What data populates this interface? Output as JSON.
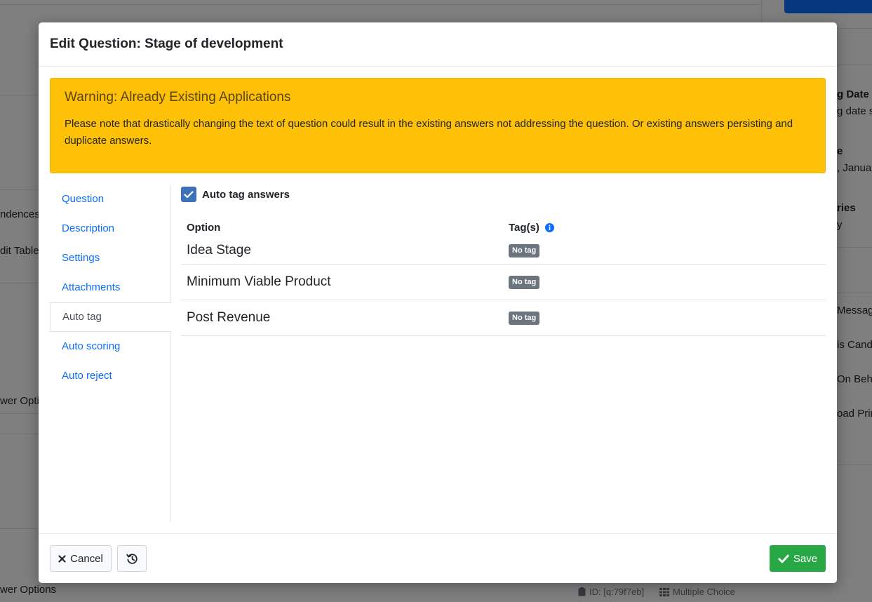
{
  "background": {
    "left_fragments": [
      "ndences",
      "dit Table",
      "wer Opti",
      "wer Options"
    ],
    "right_fragments": [
      "g Date",
      "g date se",
      "e",
      ", Janua",
      "ries",
      "y",
      "Message",
      "is Candi",
      "On Beha",
      "oad Prin"
    ],
    "footer": {
      "id_label": "ID: [q:79f7eb]",
      "type_label": "Multiple Choice"
    }
  },
  "modal": {
    "title": "Edit Question: Stage of development",
    "alert": {
      "heading": "Warning: Already Existing Applications",
      "text": "Please note that drastically changing the text of question could result in the existing answers not addressing the question. Or existing answers persisting and duplicate answers."
    },
    "nav": [
      {
        "label": "Question",
        "active": false
      },
      {
        "label": "Description",
        "active": false
      },
      {
        "label": "Settings",
        "active": false
      },
      {
        "label": "Attachments",
        "active": false
      },
      {
        "label": "Auto tag",
        "active": true
      },
      {
        "label": "Auto scoring",
        "active": false
      },
      {
        "label": "Auto reject",
        "active": false
      }
    ],
    "auto_tag": {
      "checkbox_label": "Auto tag answers",
      "checked": true,
      "columns": {
        "option": "Option",
        "tags": "Tag(s)"
      },
      "rows": [
        {
          "option": "Idea Stage",
          "tag": "No tag"
        },
        {
          "option": "Minimum Viable Product",
          "tag": "No tag"
        },
        {
          "option": "Post Revenue",
          "tag": "No tag"
        }
      ]
    },
    "footer": {
      "cancel_label": "Cancel",
      "save_label": "Save"
    }
  },
  "colors": {
    "accent": "#0d6efd",
    "warning": "#ffc107",
    "success": "#28a745",
    "badge": "#6c757d"
  }
}
